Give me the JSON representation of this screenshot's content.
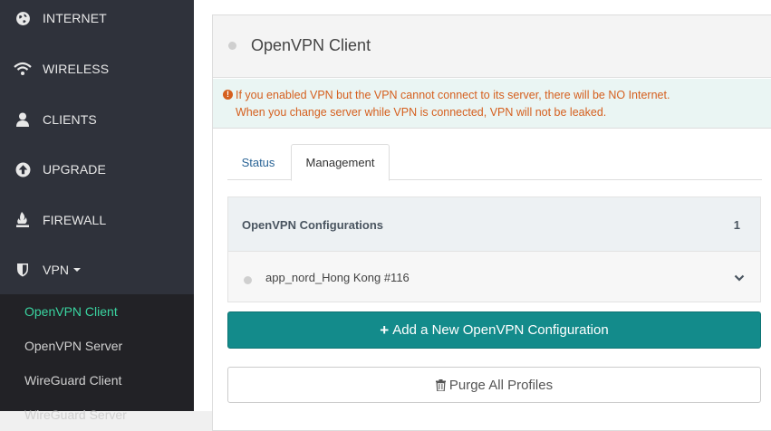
{
  "sidebar": {
    "items": [
      {
        "label": "INTERNET",
        "icon": "globe-icon"
      },
      {
        "label": "WIRELESS",
        "icon": "wifi-icon"
      },
      {
        "label": "CLIENTS",
        "icon": "user-icon"
      },
      {
        "label": "UPGRADE",
        "icon": "upload-icon"
      },
      {
        "label": "FIREWALL",
        "icon": "fire-icon"
      },
      {
        "label": "VPN",
        "icon": "shield-icon"
      }
    ],
    "vpn_submenu": [
      "OpenVPN Client",
      "OpenVPN Server",
      "WireGuard Client",
      "WireGuard Server"
    ]
  },
  "panel": {
    "title": "OpenVPN Client",
    "alert_line1": "If you enabled VPN but the VPN cannot connect to its server, there will be NO Internet.",
    "alert_line2": "When you change server while VPN is connected, VPN will not be leaked."
  },
  "tabs": [
    "Status",
    "Management"
  ],
  "configurations": {
    "header": "OpenVPN Configurations",
    "count": "1",
    "items": [
      "app_nord_Hong Kong #116"
    ]
  },
  "buttons": {
    "add": "Add a New OpenVPN Configuration",
    "purge": "Purge All Profiles"
  },
  "colors": {
    "accent": "#138b8b",
    "active_menu": "#3ad4a0",
    "warning": "#d55f1e"
  }
}
